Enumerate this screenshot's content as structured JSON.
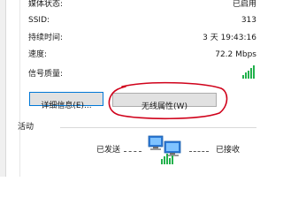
{
  "details": {
    "media_state": {
      "label": "媒体状态:",
      "value": "已启用"
    },
    "ssid": {
      "label": "SSID:",
      "value": "313"
    },
    "duration": {
      "label": "持续时间:",
      "value": "3 天 19:43:16"
    },
    "speed": {
      "label": "速度:",
      "value": "72.2 Mbps"
    },
    "signal": {
      "label": "信号质量:",
      "level": 1.0
    }
  },
  "buttons": {
    "details_label": "详细信息(E)...",
    "wireless_label": "无线属性(W)"
  },
  "activity": {
    "title": "活动",
    "sent_label": "已发送",
    "received_label": "已接收"
  },
  "colors": {
    "signal_green": "#22b14c",
    "annotation_red": "#d0021b",
    "focus_blue": "#0078d7"
  }
}
